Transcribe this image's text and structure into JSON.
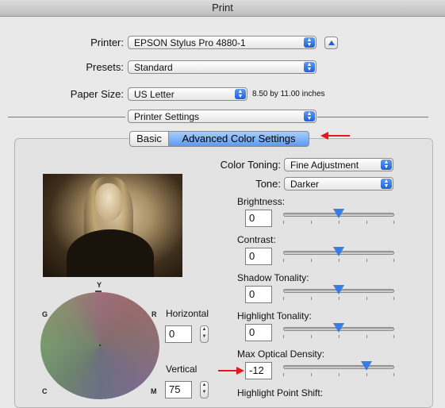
{
  "window": {
    "title": "Print"
  },
  "printer": {
    "label": "Printer:",
    "value": "EPSON Stylus Pro 4880-1"
  },
  "presets": {
    "label": "Presets:",
    "value": "Standard"
  },
  "paper": {
    "label": "Paper Size:",
    "value": "US Letter",
    "dimensions": "8.50 by 11.00 inches"
  },
  "section_popup": {
    "value": "Printer Settings"
  },
  "tabs": [
    {
      "label": "Basic"
    },
    {
      "label": "Advanced Color Settings"
    }
  ],
  "color_toning": {
    "label": "Color Toning:",
    "value": "Fine Adjustment"
  },
  "tone": {
    "label": "Tone:",
    "value": "Darker"
  },
  "sliders": [
    {
      "label": "Brightness:",
      "value": "0",
      "level": 0.5
    },
    {
      "label": "Contrast:",
      "value": "0",
      "level": 0.5
    },
    {
      "label": "Shadow Tonality:",
      "value": "0",
      "level": 0.5
    },
    {
      "label": "Highlight Tonality:",
      "value": "0",
      "level": 0.5
    },
    {
      "label": "Max Optical Density:",
      "value": "-12",
      "level": 0.75
    }
  ],
  "next_label": "Highlight Point Shift:",
  "color_wheel": {
    "top": "Y",
    "left": "G",
    "right": "R",
    "bottom_left": "C",
    "bottom_right": "M"
  },
  "horizontal": {
    "label": "Horizontal",
    "value": "0"
  },
  "vertical": {
    "label": "Vertical",
    "value": "75"
  },
  "colors": {
    "accent": "#3c7be0",
    "annotation_arrow": "#e1191f"
  }
}
